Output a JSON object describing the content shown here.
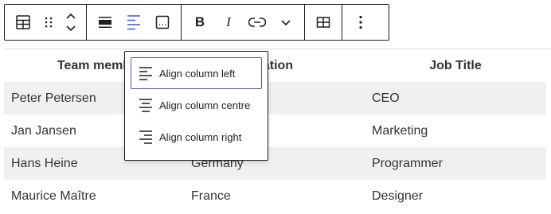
{
  "toolbar": {
    "groups": [
      [
        "table-block-icon",
        "drag-handle-icon",
        "move-up-down-icon"
      ],
      [
        "align-block-icon",
        "align-column-icon",
        "block-caption-icon"
      ],
      [
        "bold-icon",
        "italic-icon",
        "link-icon",
        "chevron-down-icon"
      ],
      [
        "edit-table-icon"
      ],
      [
        "more-options-icon"
      ]
    ],
    "bold_glyph": "B",
    "italic_glyph": "I",
    "accent_color": "#3858e9"
  },
  "table": {
    "headers": [
      "Team memb",
      "cation",
      "Job Title"
    ],
    "rows": [
      [
        "Peter Petersen",
        "",
        "CEO"
      ],
      [
        "Jan Jansen",
        "",
        "Marketing"
      ],
      [
        "Hans Heine",
        "Germany",
        "Programmer"
      ],
      [
        "Maurice Maître",
        "France",
        "Designer"
      ]
    ]
  },
  "align_menu": {
    "items": [
      {
        "label": "Align column left",
        "icon": "align-left-icon"
      },
      {
        "label": "Align column centre",
        "icon": "align-center-icon"
      },
      {
        "label": "Align column right",
        "icon": "align-right-icon"
      }
    ]
  }
}
